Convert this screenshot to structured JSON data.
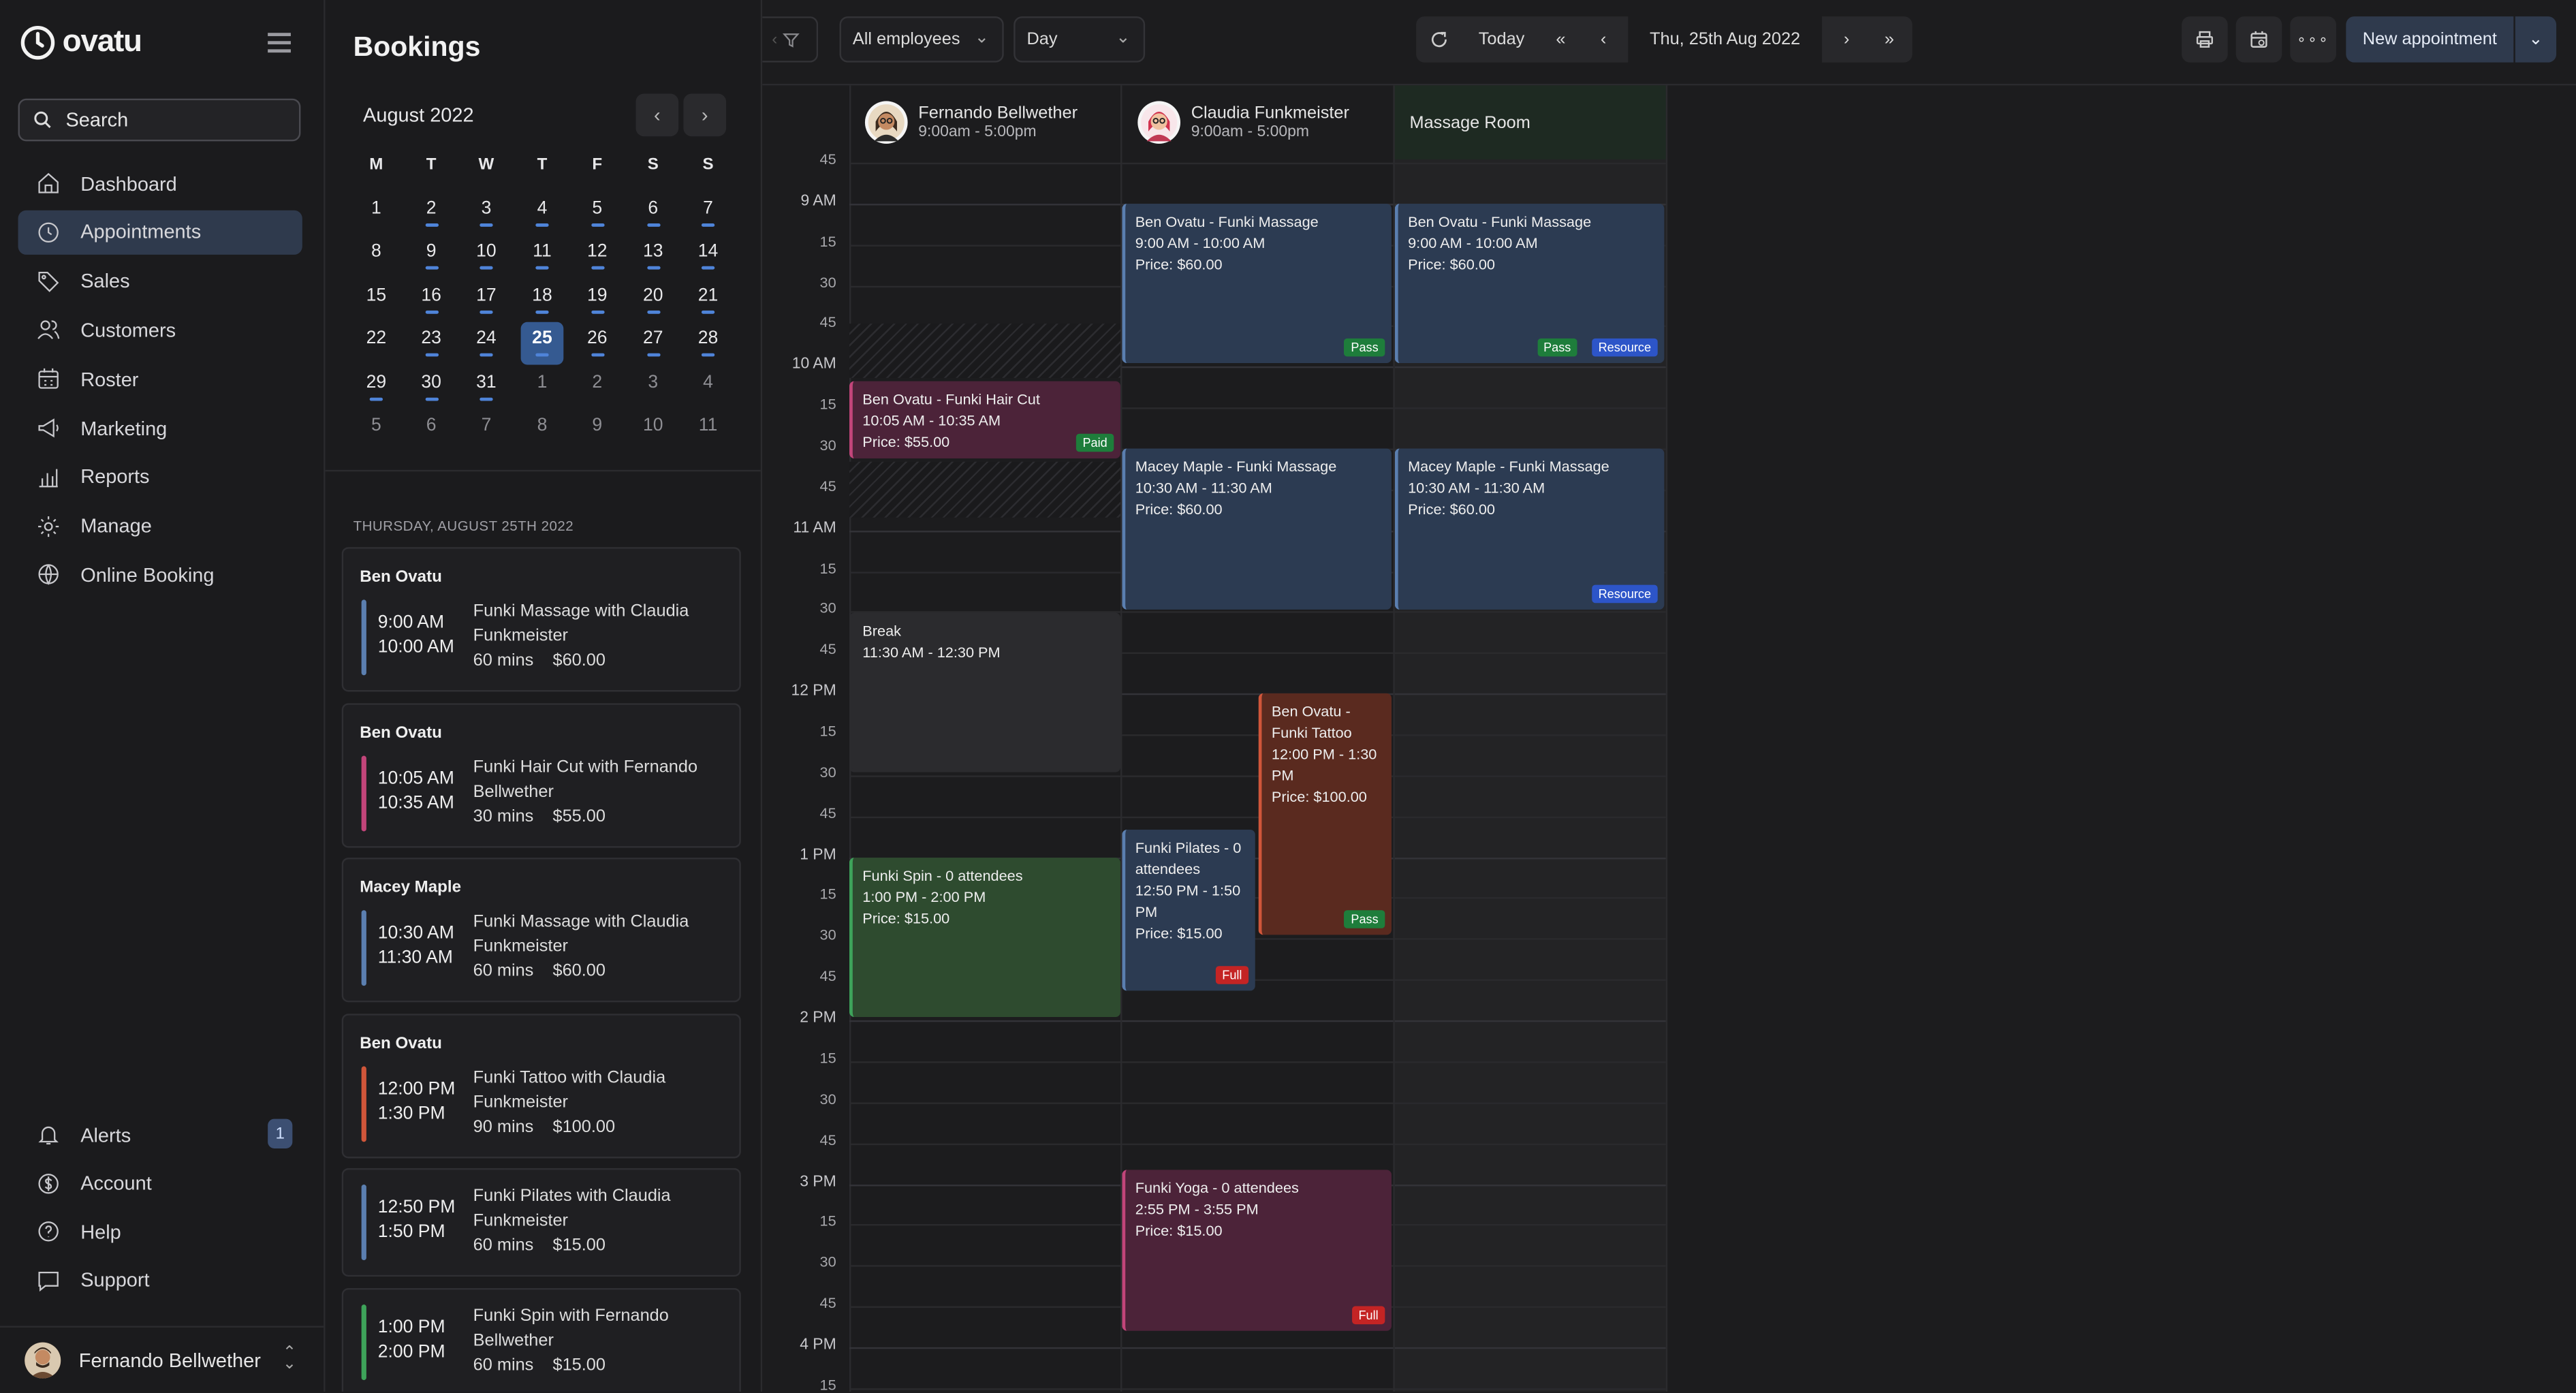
{
  "app": {
    "logo_text": "ovatu"
  },
  "sidebar": {
    "search_label": "Search",
    "items": [
      {
        "label": "Dashboard",
        "icon": "home-icon"
      },
      {
        "label": "Appointments",
        "icon": "clock-icon",
        "active": true
      },
      {
        "label": "Sales",
        "icon": "tag-icon"
      },
      {
        "label": "Customers",
        "icon": "users-icon"
      },
      {
        "label": "Roster",
        "icon": "calendar-grid-icon"
      },
      {
        "label": "Marketing",
        "icon": "megaphone-icon"
      },
      {
        "label": "Reports",
        "icon": "bar-chart-icon"
      },
      {
        "label": "Manage",
        "icon": "gear-icon"
      },
      {
        "label": "Online Booking",
        "icon": "globe-icon"
      }
    ],
    "bottom_items": [
      {
        "label": "Alerts",
        "icon": "bell-icon",
        "badge": "1"
      },
      {
        "label": "Account",
        "icon": "dollar-icon"
      },
      {
        "label": "Help",
        "icon": "help-icon"
      },
      {
        "label": "Support",
        "icon": "chat-icon"
      }
    ],
    "user_name": "Fernando Bellwether"
  },
  "bookings": {
    "title": "Bookings",
    "month_label": "August 2022",
    "weekdays": [
      "M",
      "T",
      "W",
      "T",
      "F",
      "S",
      "S"
    ],
    "weeks": [
      [
        {
          "d": "1"
        },
        {
          "d": "2",
          "dot": true
        },
        {
          "d": "3",
          "dot": true
        },
        {
          "d": "4",
          "dot": true
        },
        {
          "d": "5",
          "dot": true
        },
        {
          "d": "6",
          "dot": true
        },
        {
          "d": "7",
          "dot": true
        }
      ],
      [
        {
          "d": "8"
        },
        {
          "d": "9",
          "dot": true
        },
        {
          "d": "10",
          "dot": true
        },
        {
          "d": "11",
          "dot": true
        },
        {
          "d": "12",
          "dot": true
        },
        {
          "d": "13",
          "dot": true
        },
        {
          "d": "14",
          "dot": true
        }
      ],
      [
        {
          "d": "15"
        },
        {
          "d": "16",
          "dot": true
        },
        {
          "d": "17",
          "dot": true
        },
        {
          "d": "18",
          "dot": true
        },
        {
          "d": "19",
          "dot": true
        },
        {
          "d": "20",
          "dot": true
        },
        {
          "d": "21",
          "dot": true
        }
      ],
      [
        {
          "d": "22"
        },
        {
          "d": "23",
          "dot": true
        },
        {
          "d": "24",
          "dot": true
        },
        {
          "d": "25",
          "dot": true,
          "selected": true
        },
        {
          "d": "26",
          "dot": true
        },
        {
          "d": "27",
          "dot": true
        },
        {
          "d": "28",
          "dot": true
        }
      ],
      [
        {
          "d": "29",
          "dot": true
        },
        {
          "d": "30",
          "dot": true
        },
        {
          "d": "31",
          "dot": true
        },
        {
          "d": "1",
          "dim": true
        },
        {
          "d": "2",
          "dim": true
        },
        {
          "d": "3",
          "dim": true
        },
        {
          "d": "4",
          "dim": true
        }
      ],
      [
        {
          "d": "5",
          "dim": true
        },
        {
          "d": "6",
          "dim": true
        },
        {
          "d": "7",
          "dim": true
        },
        {
          "d": "8",
          "dim": true
        },
        {
          "d": "9",
          "dim": true
        },
        {
          "d": "10",
          "dim": true
        },
        {
          "d": "11",
          "dim": true
        }
      ]
    ],
    "date_heading": "THURSDAY, AUGUST 25TH 2022",
    "cards": [
      {
        "name": "Ben Ovatu",
        "start": "9:00 AM",
        "end": "10:00 AM",
        "service": "Funki Massage with Claudia Funkmeister",
        "duration": "60 mins",
        "price": "$60.00",
        "color": "#5b7fb0"
      },
      {
        "name": "Ben Ovatu",
        "start": "10:05 AM",
        "end": "10:35 AM",
        "service": "Funki Hair Cut with Fernando Bellwether",
        "duration": "30 mins",
        "price": "$55.00",
        "color": "#c2457a"
      },
      {
        "name": "Macey Maple",
        "start": "10:30 AM",
        "end": "11:30 AM",
        "service": "Funki Massage with Claudia Funkmeister",
        "duration": "60 mins",
        "price": "$60.00",
        "color": "#5b7fb0"
      },
      {
        "name": "Ben Ovatu",
        "start": "12:00 PM",
        "end": "1:30 PM",
        "service": "Funki Tattoo with Claudia Funkmeister",
        "duration": "90 mins",
        "price": "$100.00",
        "color": "#d0563a"
      },
      {
        "name": "",
        "start": "12:50 PM",
        "end": "1:50 PM",
        "service": "Funki Pilates with Claudia Funkmeister",
        "duration": "60 mins",
        "price": "$15.00",
        "color": "#5b7fb0"
      },
      {
        "name": "",
        "start": "1:00 PM",
        "end": "2:00 PM",
        "service": "Funki Spin with Fernando Bellwether",
        "duration": "60 mins",
        "price": "$15.00",
        "color": "#3ea35a"
      }
    ]
  },
  "toolbar": {
    "employees_select": "All employees",
    "view_select": "Day",
    "today_label": "Today",
    "date_label": "Thu, 25th Aug 2022",
    "new_appointment_label": "New appointment"
  },
  "columns": [
    {
      "name": "Fernando Bellwether",
      "hours": "9:00am - 5:00pm",
      "avatar": "avatar-fernando"
    },
    {
      "name": "Claudia Funkmeister",
      "hours": "9:00am - 5:00pm",
      "avatar": "avatar-claudia"
    },
    {
      "name": "Massage Room",
      "hours": "",
      "avatar": ""
    }
  ],
  "time_labels": [
    "45",
    "9 AM",
    "15",
    "30",
    "45",
    "10 AM",
    "15",
    "30",
    "45",
    "11 AM",
    "15",
    "30",
    "45",
    "12 PM",
    "15",
    "30",
    "45",
    "1 PM",
    "15",
    "30",
    "45",
    "2 PM",
    "15",
    "30",
    "45",
    "3 PM",
    "15",
    "30",
    "45",
    "4 PM",
    "15"
  ],
  "appointments": [
    {
      "title": "Ben Ovatu - Funki Massage",
      "time": "9:00 AM - 10:00 AM",
      "price": "Price: $60.00",
      "tags": [
        "Pass"
      ]
    },
    {
      "title": "Ben Ovatu - Funki Massage",
      "time": "9:00 AM - 10:00 AM",
      "price": "Price: $60.00",
      "tags": [
        "Pass",
        "Resource"
      ]
    },
    {
      "title": "Ben Ovatu - Funki Hair Cut",
      "time": "10:05 AM - 10:35 AM",
      "price": "Price: $55.00",
      "tags": [
        "Paid"
      ]
    },
    {
      "title": "Macey Maple - Funki Massage",
      "time": "10:30 AM - 11:30 AM",
      "price": "Price: $60.00",
      "tags": []
    },
    {
      "title": "Macey Maple - Funki Massage",
      "time": "10:30 AM - 11:30 AM",
      "price": "Price: $60.00",
      "tags": [
        "Resource"
      ]
    },
    {
      "title": "Break",
      "time": "11:30 AM - 12:30 PM",
      "price": "",
      "tags": []
    },
    {
      "title": "Ben Ovatu - Funki Tattoo",
      "time": "12:00 PM - 1:30 PM",
      "price": "Price: $100.00",
      "tags": [
        "Pass"
      ]
    },
    {
      "title": "Funki Pilates - 0 attendees",
      "time": "12:50 PM - 1:50 PM",
      "price": "Price: $15.00",
      "tags": [
        "Full"
      ]
    },
    {
      "title": "Funki Spin - 0 attendees",
      "time": "1:00 PM - 2:00 PM",
      "price": "Price: $15.00",
      "tags": []
    },
    {
      "title": "Funki Yoga - 0 attendees",
      "time": "2:55 PM - 3:55 PM",
      "price": "Price: $15.00",
      "tags": [
        "Full"
      ]
    }
  ]
}
